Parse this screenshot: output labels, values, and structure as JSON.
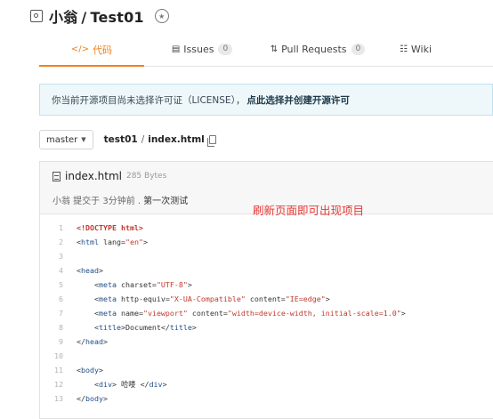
{
  "repo": {
    "owner": "小翁",
    "separator": "/",
    "name": "Test01"
  },
  "tabs": [
    {
      "label": "代码",
      "icon": "code-icon"
    },
    {
      "label": "Issues",
      "count": "0",
      "icon": "issues-icon"
    },
    {
      "label": "Pull Requests",
      "count": "0",
      "icon": "pull-request-icon"
    },
    {
      "label": "Wiki",
      "icon": "wiki-icon"
    }
  ],
  "notice": {
    "text": "你当前开源项目尚未选择许可证（LICENSE），",
    "link": "点此选择并创建开源许可"
  },
  "branch": {
    "selected": "master"
  },
  "breadcrumb": {
    "repo": "test01",
    "separator": "/",
    "file": "index.html"
  },
  "file": {
    "name": "index.html",
    "size": "285 Bytes",
    "commit_meta": "小翁 提交于 3分钟前 .",
    "commit_message": "第一次测试"
  },
  "annotation": "刷新页面即可出现项目",
  "code": [
    {
      "n": "1",
      "text": "<!DOCTYPE html>"
    },
    {
      "n": "2",
      "text": "<html lang=\"en\">"
    },
    {
      "n": "3",
      "text": ""
    },
    {
      "n": "4",
      "text": "<head>"
    },
    {
      "n": "5",
      "text": "    <meta charset=\"UTF-8\">"
    },
    {
      "n": "6",
      "text": "    <meta http-equiv=\"X-UA-Compatible\" content=\"IE=edge\">"
    },
    {
      "n": "7",
      "text": "    <meta name=\"viewport\" content=\"width=device-width, initial-scale=1.0\">"
    },
    {
      "n": "8",
      "text": "    <title>Document</title>"
    },
    {
      "n": "9",
      "text": "</head>"
    },
    {
      "n": "10",
      "text": ""
    },
    {
      "n": "11",
      "text": "<body>"
    },
    {
      "n": "12",
      "text": "    <div> 哈喽 </div>"
    },
    {
      "n": "13",
      "text": "</body>"
    }
  ],
  "colors": {
    "accent": "#f08020",
    "annotation": "#e53935",
    "notice_bg": "#eef7fa"
  }
}
